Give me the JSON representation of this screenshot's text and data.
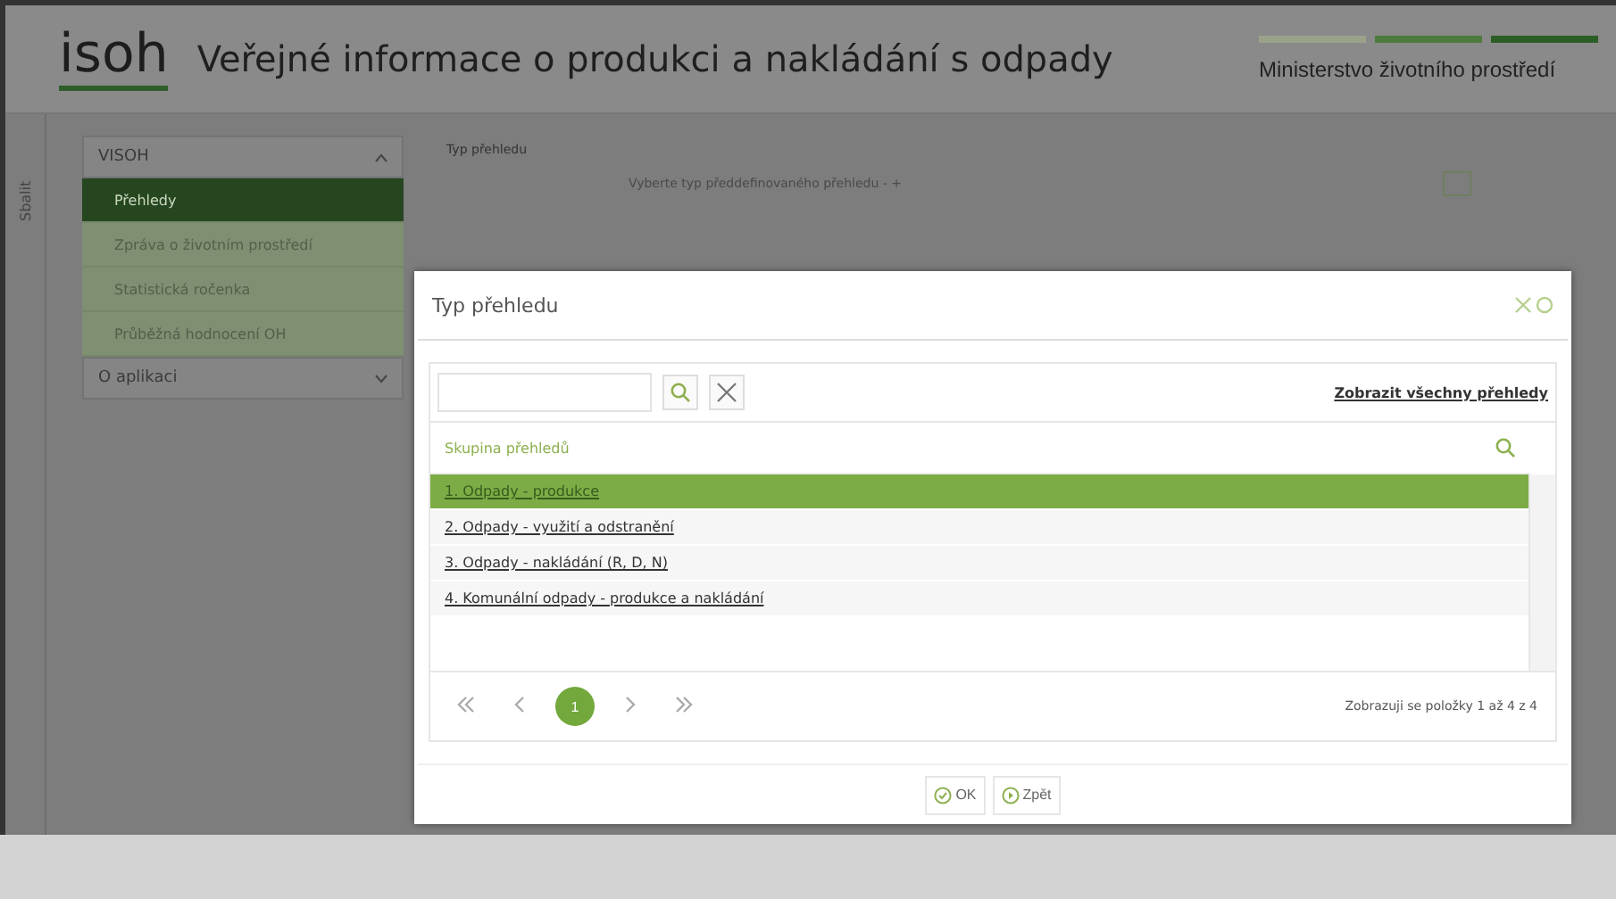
{
  "header": {
    "logo": "isoh",
    "title": "Veřejné informace o produkci a nakládání s odpady",
    "ministry": "Ministerstvo životního prostředí"
  },
  "side_tab": "Sbalit",
  "sidebar": {
    "sections": [
      {
        "label": "VISOH",
        "expanded": true,
        "items": [
          {
            "label": "Přehledy",
            "selected": true
          },
          {
            "label": "Zpráva o životním prostředí",
            "selected": false
          },
          {
            "label": "Statistická ročenka",
            "selected": false
          },
          {
            "label": "Průběžná hodnocení OH",
            "selected": false
          }
        ]
      },
      {
        "label": "O aplikaci",
        "expanded": false
      }
    ]
  },
  "form": {
    "label": "Typ přehledu",
    "select": "Vyberte typ předdefinovaného přehledu - +"
  },
  "dialog": {
    "title": "Typ přehledu",
    "show_all": "Zobrazit všechny přehledy",
    "column": "Skupina přehledů",
    "rows": [
      {
        "label": "1. Odpady - produkce",
        "selected": true
      },
      {
        "label": "2. Odpady - využití a odstranění",
        "selected": false
      },
      {
        "label": "3. Odpady - nakládání (R, D, N)",
        "selected": false
      },
      {
        "label": "4. Komunální odpady - produkce a nakládání",
        "selected": false
      }
    ],
    "pages": [
      {
        "label": "1",
        "selected": true
      }
    ],
    "pager_info": "Zobrazuji se položky 1 až 4 z 4",
    "buttons": [
      {
        "label": "OK",
        "kind": "ok"
      },
      {
        "label": "Zpět",
        "kind": "back"
      }
    ]
  }
}
